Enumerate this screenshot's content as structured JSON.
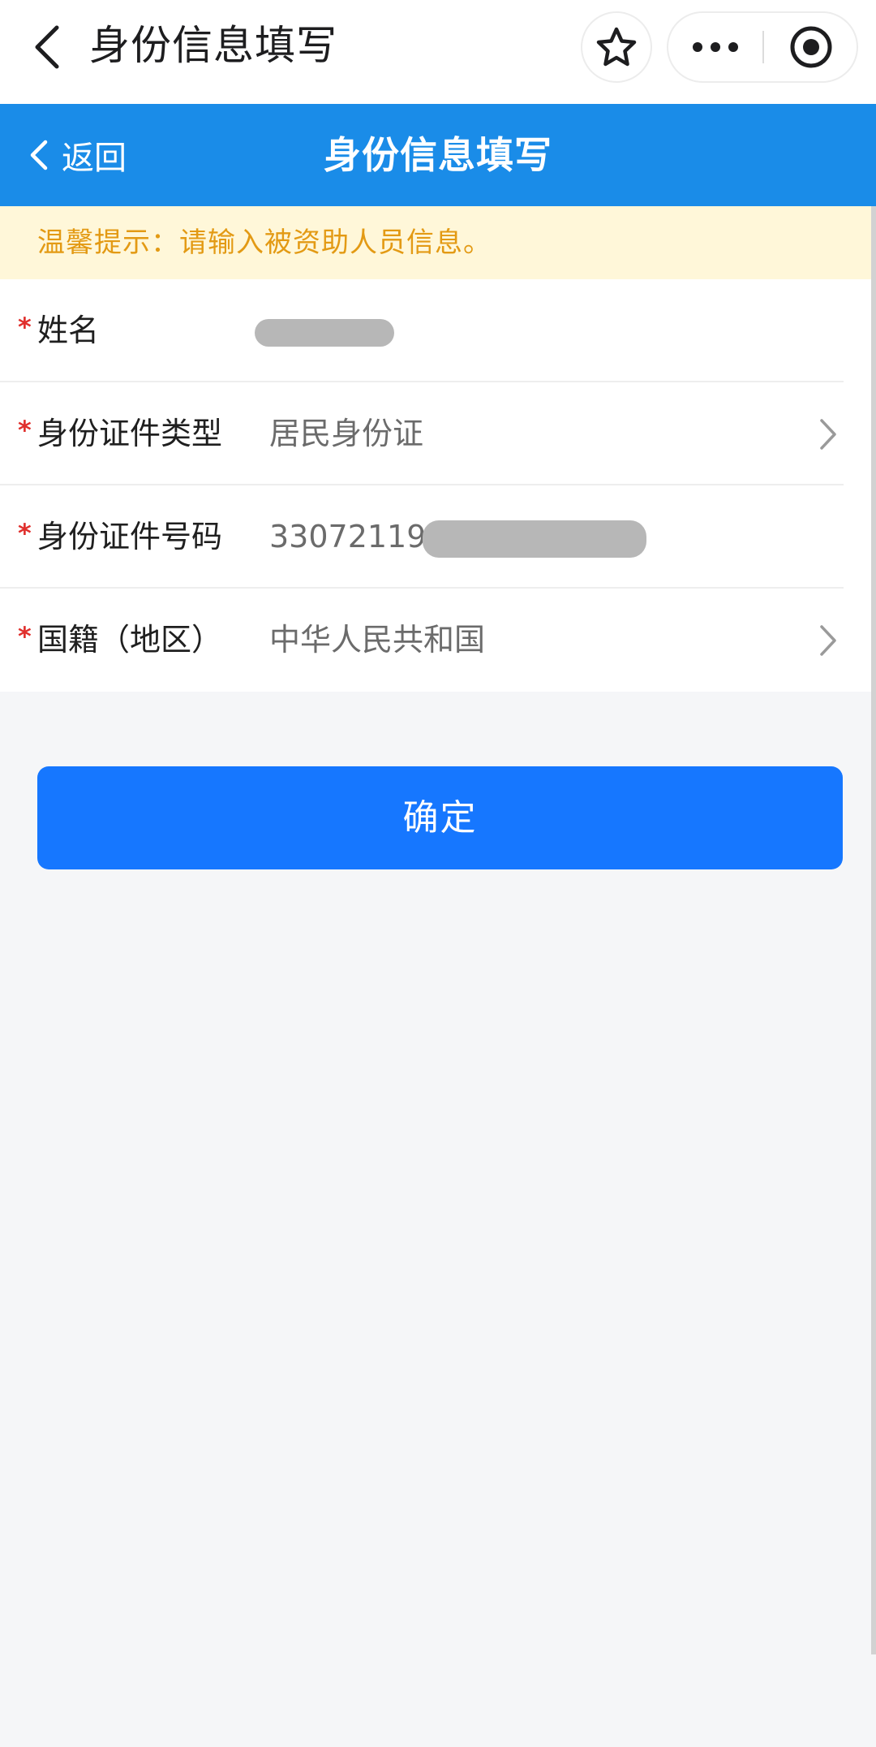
{
  "mp_bar": {
    "title": "身份信息填写",
    "icons": {
      "back": "chevron-left-icon",
      "favorite": "star-outline-icon",
      "more": "more-dots-icon",
      "close": "target-close-icon"
    }
  },
  "header": {
    "back_label": "返回",
    "title": "身份信息填写",
    "background_color": "#1a8ce8"
  },
  "tip": {
    "text": "温馨提示：请输入被资助人员信息。",
    "text_color": "#e39a14",
    "background_color": "#fff7d9"
  },
  "form": {
    "required_symbol": "*",
    "fields": [
      {
        "label": "姓名",
        "value": "",
        "redacted": true
      },
      {
        "label": "身份证件类型",
        "value": "居民身份证",
        "has_arrow": true
      },
      {
        "label": "身份证件号码",
        "value": "33072119",
        "redacted": true
      },
      {
        "label": "国籍（地区）",
        "value": "中华人民共和国",
        "has_arrow": true
      }
    ]
  },
  "confirm": {
    "label": "确定",
    "color": "#1677ff"
  }
}
